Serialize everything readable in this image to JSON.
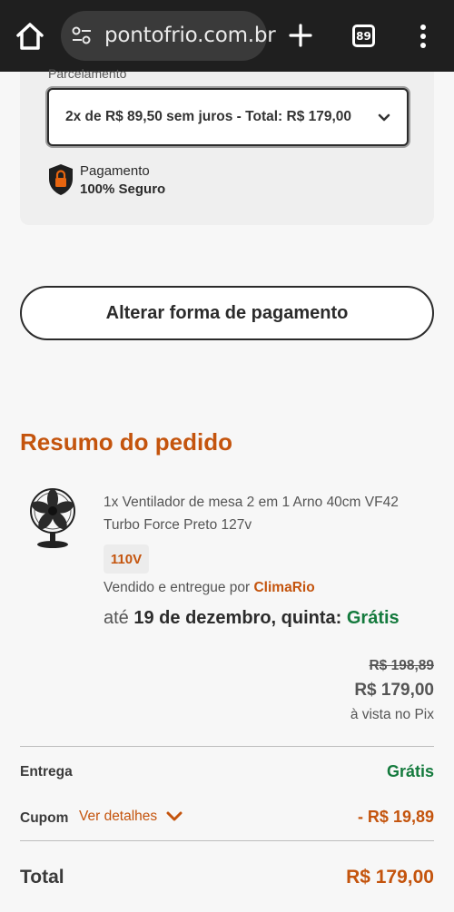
{
  "browser": {
    "url": "pontofrio.com.br",
    "tab_count": "89"
  },
  "installment": {
    "label": "Parcelamento",
    "selected": "2x de R$ 89,50 sem juros - Total: R$ 179,00"
  },
  "secure": {
    "line1": "Pagamento",
    "line2": "100% Seguro"
  },
  "change_payment_label": "Alterar forma de pagamento",
  "summary": {
    "title": "Resumo do pedido",
    "product_name": "1x Ventilador de mesa 2 em 1 Arno 40cm VF42 Turbo Force Preto 127v",
    "voltage": "110V",
    "seller_prefix": "Vendido e entregue por",
    "seller_name": "ClimaRio",
    "delivery_prefix": "até",
    "delivery_date": "19 de dezembro, quinta:",
    "delivery_cost": "Grátis",
    "price_old": "R$ 198,89",
    "price_new": "R$ 179,00",
    "price_note": "à vista no Pix"
  },
  "totals": {
    "entrega_label": "Entrega",
    "entrega_value": "Grátis",
    "cupom_label": "Cupom",
    "cupom_link": "Ver detalhes",
    "cupom_value": "- R$ 19,89",
    "total_label": "Total",
    "total_value": "R$ 179,00"
  },
  "colors": {
    "accent": "#c4540d",
    "green": "#147a3d",
    "topbar": "#1f1f1f"
  }
}
